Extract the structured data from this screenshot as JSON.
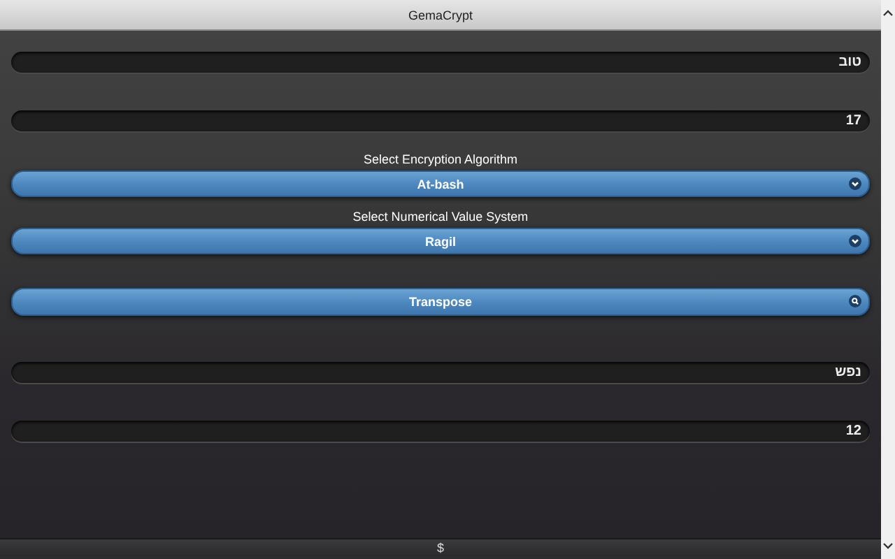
{
  "window": {
    "title": "GemaCrypt"
  },
  "input_text": {
    "value": "טוב"
  },
  "input_value": {
    "value": "17"
  },
  "algorithm": {
    "label": "Select Encryption Algorithm",
    "value": "At-bash"
  },
  "value_system": {
    "label": "Select Numerical Value System",
    "value": "Ragil"
  },
  "transpose_button": {
    "label": "Transpose"
  },
  "output_text": {
    "value": "נפש"
  },
  "output_value": {
    "value": "12"
  },
  "footer": {
    "text": "$"
  }
}
